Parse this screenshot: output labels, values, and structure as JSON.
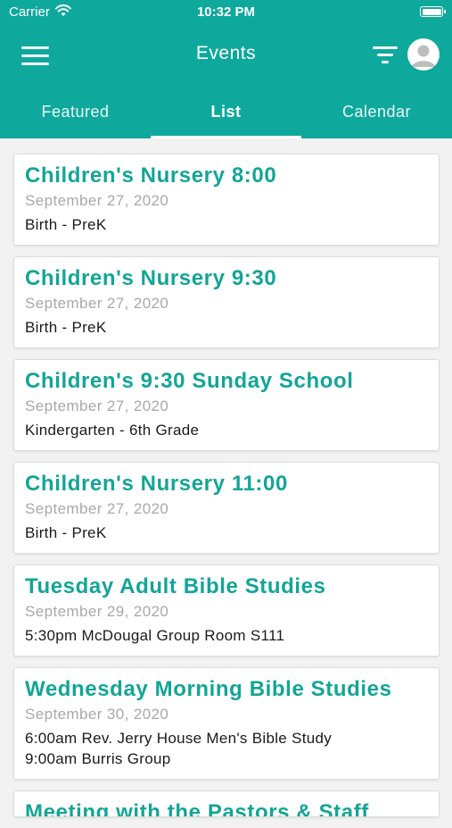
{
  "status_bar": {
    "carrier": "Carrier",
    "time": "10:32 PM"
  },
  "header": {
    "title": "Events",
    "background_color": "#0fa89c"
  },
  "tabs": [
    {
      "label": "Featured",
      "active": false
    },
    {
      "label": "List",
      "active": true
    },
    {
      "label": "Calendar",
      "active": false
    }
  ],
  "events": [
    {
      "title": "Children's Nursery 8:00",
      "date": "September 27, 2020",
      "desc": [
        "Birth - PreK"
      ]
    },
    {
      "title": "Children's Nursery 9:30",
      "date": "September 27, 2020",
      "desc": [
        "Birth - PreK"
      ]
    },
    {
      "title": "Children's 9:30 Sunday School",
      "date": "September 27, 2020",
      "desc": [
        "Kindergarten - 6th Grade"
      ]
    },
    {
      "title": "Children's Nursery 11:00",
      "date": "September 27, 2020",
      "desc": [
        "Birth - PreK"
      ]
    },
    {
      "title": "Tuesday Adult Bible Studies",
      "date": "September 29, 2020",
      "desc": [
        "5:30pm McDougal Group Room S111"
      ]
    },
    {
      "title": "Wednesday Morning Bible Studies",
      "date": "September 30, 2020",
      "desc": [
        "6:00am Rev. Jerry House Men's Bible Study",
        "9:00am Burris Group"
      ]
    },
    {
      "title": "Meeting with the Pastors & Staff",
      "date": "",
      "desc": []
    }
  ],
  "colors": {
    "accent": "#13a597",
    "date_text": "#a8a8a8",
    "body_text": "#1a1a1a"
  },
  "icons": [
    "wifi-icon",
    "battery-icon",
    "menu-icon",
    "filter-icon",
    "avatar-icon"
  ]
}
